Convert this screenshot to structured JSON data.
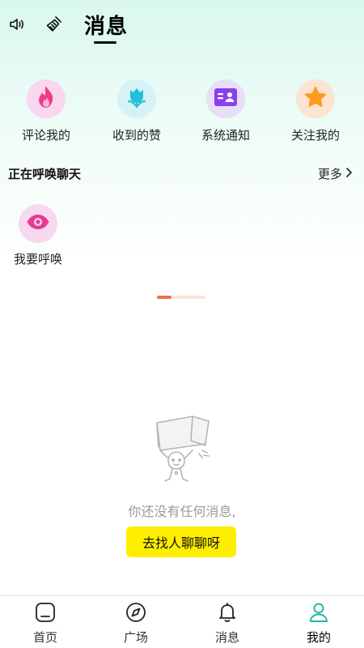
{
  "header": {
    "title": "消息",
    "left_icons": [
      "speaker-icon",
      "broom-icon"
    ]
  },
  "quick_actions": [
    {
      "label": "评论我的",
      "icon": "fire-icon",
      "bg": "#f8d7ef",
      "fg": "#f03a8a"
    },
    {
      "label": "收到的赞",
      "icon": "tulip-icon",
      "bg": "#d6f2f7",
      "fg": "#22c0da"
    },
    {
      "label": "系统通知",
      "icon": "id-card-icon",
      "bg": "#e8def8",
      "fg": "#8a3ff0"
    },
    {
      "label": "关注我的",
      "icon": "star-icon",
      "bg": "#fde3d2",
      "fg": "#ff9a1f"
    }
  ],
  "calling": {
    "section_title": "正在呼唤聊天",
    "more_label": "更多",
    "items": [
      {
        "label": "我要呼唤",
        "icon": "eye-icon"
      }
    ]
  },
  "pager": {
    "active_index": 0
  },
  "empty_state": {
    "message": "你还没有任何消息,",
    "cta_label": "去找人聊聊呀"
  },
  "tabbar": {
    "tabs": [
      {
        "label": "首页",
        "icon": "home-icon",
        "active": false
      },
      {
        "label": "广场",
        "icon": "compass-icon",
        "active": false
      },
      {
        "label": "消息",
        "icon": "bell-icon",
        "active": false
      },
      {
        "label": "我的",
        "icon": "user-icon",
        "active": true
      }
    ],
    "accent": "#1fb89a"
  }
}
